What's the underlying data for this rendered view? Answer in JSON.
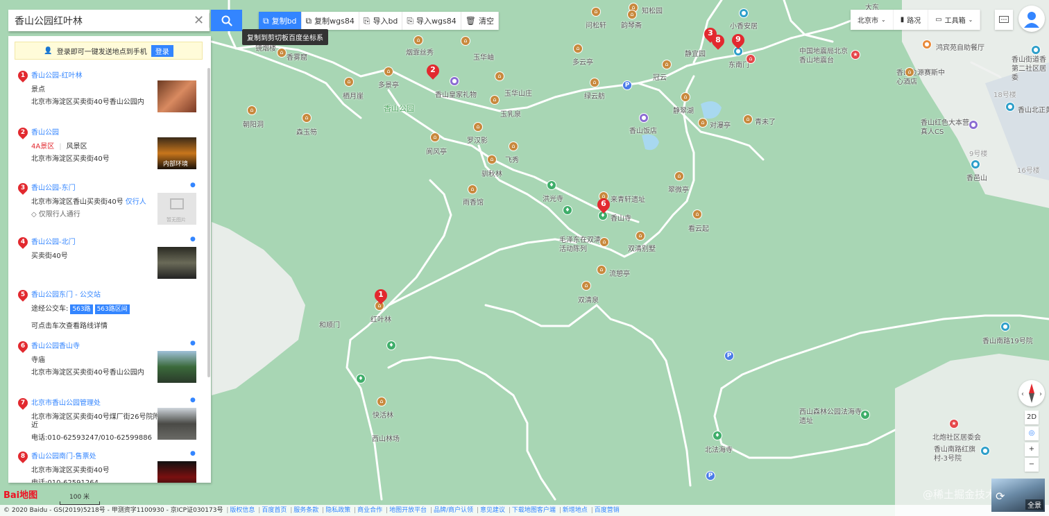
{
  "search": {
    "value": "香山公园红叶林",
    "clear_icon": "close-icon",
    "search_icon": "search-icon"
  },
  "toolbar": {
    "buttons": [
      {
        "label": "复制bd",
        "icon": "copy-icon"
      },
      {
        "label": "复制wgs84",
        "icon": "copy-icon"
      },
      {
        "label": "导入bd",
        "icon": "import-icon"
      },
      {
        "label": "导入wgs84",
        "icon": "import-icon"
      },
      {
        "label": "清空",
        "icon": "trash-icon"
      }
    ],
    "tooltip": "复制到剪切板百度坐标系",
    "active_color": "#3385ff"
  },
  "top_right": {
    "city": "北京市",
    "traffic": "路况",
    "toolbox": "工具箱"
  },
  "panel": {
    "login_text": "登录即可一键发送地点到手机",
    "login_button": "登录",
    "results": [
      {
        "num": "1",
        "title": "香山公园-红叶林",
        "line1": "景点",
        "line2": "北京市海淀区买卖街40号香山公园内"
      },
      {
        "num": "2",
        "title": "香山公园",
        "grade": "4A景区",
        "kind": "风景区",
        "line2": "北京市海淀区买卖街40号",
        "thumb_caption": "内部环境"
      },
      {
        "num": "3",
        "title": "香山公园-东门",
        "line1": "北京市海淀区香山买卖街40号",
        "line1_link": "仅行人",
        "line2": "仅限行人通行",
        "thumb_caption": "暂无图片"
      },
      {
        "num": "4",
        "title": "香山公园-北门",
        "line1": "买卖街40号"
      },
      {
        "num": "5",
        "title": "香山公园东门 - 公交站",
        "bus_label": "途经公交车:",
        "bus_tags": [
          "563路",
          "563路区间"
        ],
        "line2": "可点击车次查看路线详情"
      },
      {
        "num": "6",
        "title": "香山公园香山寺",
        "line1": "寺庙",
        "line2": "北京市海淀区买卖街40号香山公园内"
      },
      {
        "num": "7",
        "title": "北京市香山公园管理处",
        "line1": "北京市海淀区买卖街40号煤厂街26号院附",
        "line1b": "近",
        "line2": "电话:010-62593247/010-62599886"
      },
      {
        "num": "8",
        "title": "香山公园南门-售票处",
        "line1": "北京市海淀区买卖街40号",
        "line2": "电话:010-62591264"
      }
    ]
  },
  "map": {
    "labels": [
      "知松园",
      "问松轩",
      "韵琴斋",
      "小香安居",
      "镜烟楼",
      "香雾窟",
      "烟霏丝秀",
      "玉华岫",
      "香山皇家礼物",
      "多景亭",
      "栖月崖",
      "香山公园",
      "玉华山庄",
      "绿云舫",
      "冠云",
      "静宜园",
      "东南门",
      "静翠湖",
      "香山饭店",
      "对瀑亭",
      "青未了",
      "朝阳洞",
      "森玉笏",
      "玉乳泉",
      "罗汉影",
      "阆风亭",
      "飞秀",
      "驯秋林",
      "洪光寺",
      "来青轩遗址",
      "香山寺",
      "看云起",
      "翠微亭",
      "雨香馆",
      "毛泽东在双清活动陈列",
      "双清别墅",
      "流憩亭",
      "双清泉",
      "和顺门",
      "红叶林",
      "快活林",
      "西山林场",
      "西山森林公园法海寺遗址",
      "北法海寺",
      "北京市香山公园管理处",
      "中国地震局北京香山地震台",
      "鸿宾苑自助餐厅",
      "香山金源赛斯中心酒店",
      "香山街道香第二社区居委",
      "香山北正黄",
      "香山红色大本营真人CS",
      "香邑山",
      "香山南路19号院",
      "北炮社区居委会",
      "香山南路红旗村-3号院",
      "大东",
      "多云亭",
      "18号楼",
      "16号楼",
      "9号楼"
    ],
    "markers": [
      "1",
      "2",
      "3",
      "8",
      "9",
      "6"
    ]
  },
  "scale": "100 米",
  "logo": "Bai地图",
  "footer": {
    "copyright": "© 2020 Baidu - GS(2019)5218号 - 甲测资字1100930 - 京ICP证030173号",
    "links": [
      "版权信息",
      "百度首页",
      "服务条款",
      "隐私政策",
      "商业合作",
      "地图开放平台",
      "品牌/商户认领",
      "意见建议",
      "下载地图客户端",
      "新增地点",
      "百度营销"
    ]
  },
  "controls": {
    "mode": "2D",
    "zoom_in": "+",
    "zoom_out": "−",
    "panorama": "全景"
  },
  "watermark": "@稀土掘金技术社区"
}
